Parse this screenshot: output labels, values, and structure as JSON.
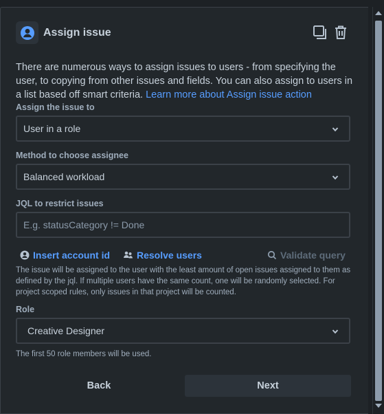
{
  "header": {
    "title": "Assign issue"
  },
  "description": {
    "text": "There are numerous ways to assign issues to users - from specifying the user, to copying from other issues and fields. You can also assign to users in a list based off smart criteria. ",
    "link_label": "Learn more about Assign issue action"
  },
  "assign_to": {
    "label": "Assign the issue to",
    "value": "User in a role"
  },
  "method": {
    "label": "Method to choose assignee",
    "value": "Balanced workload"
  },
  "jql": {
    "label": "JQL to restrict issues",
    "placeholder": "E.g. statusCategory != Done"
  },
  "actions": {
    "insert_account_id": "Insert account id",
    "resolve_users": "Resolve users",
    "validate_query": "Validate query"
  },
  "method_help": "The issue will be assigned to the user with the least amount of open issues assigned to them as defined by the jql. If multiple users have the same count, one will be randomly selected. For project scoped rules, only issues in that project will be counted.",
  "role": {
    "label": "Role",
    "value": "Creative Designer",
    "help": "The first 50 role members will be used."
  },
  "footer": {
    "back_label": "Back",
    "next_label": "Next"
  },
  "colors": {
    "link": "#579dff",
    "app_icon": "#579dff",
    "background": "#22272b"
  }
}
